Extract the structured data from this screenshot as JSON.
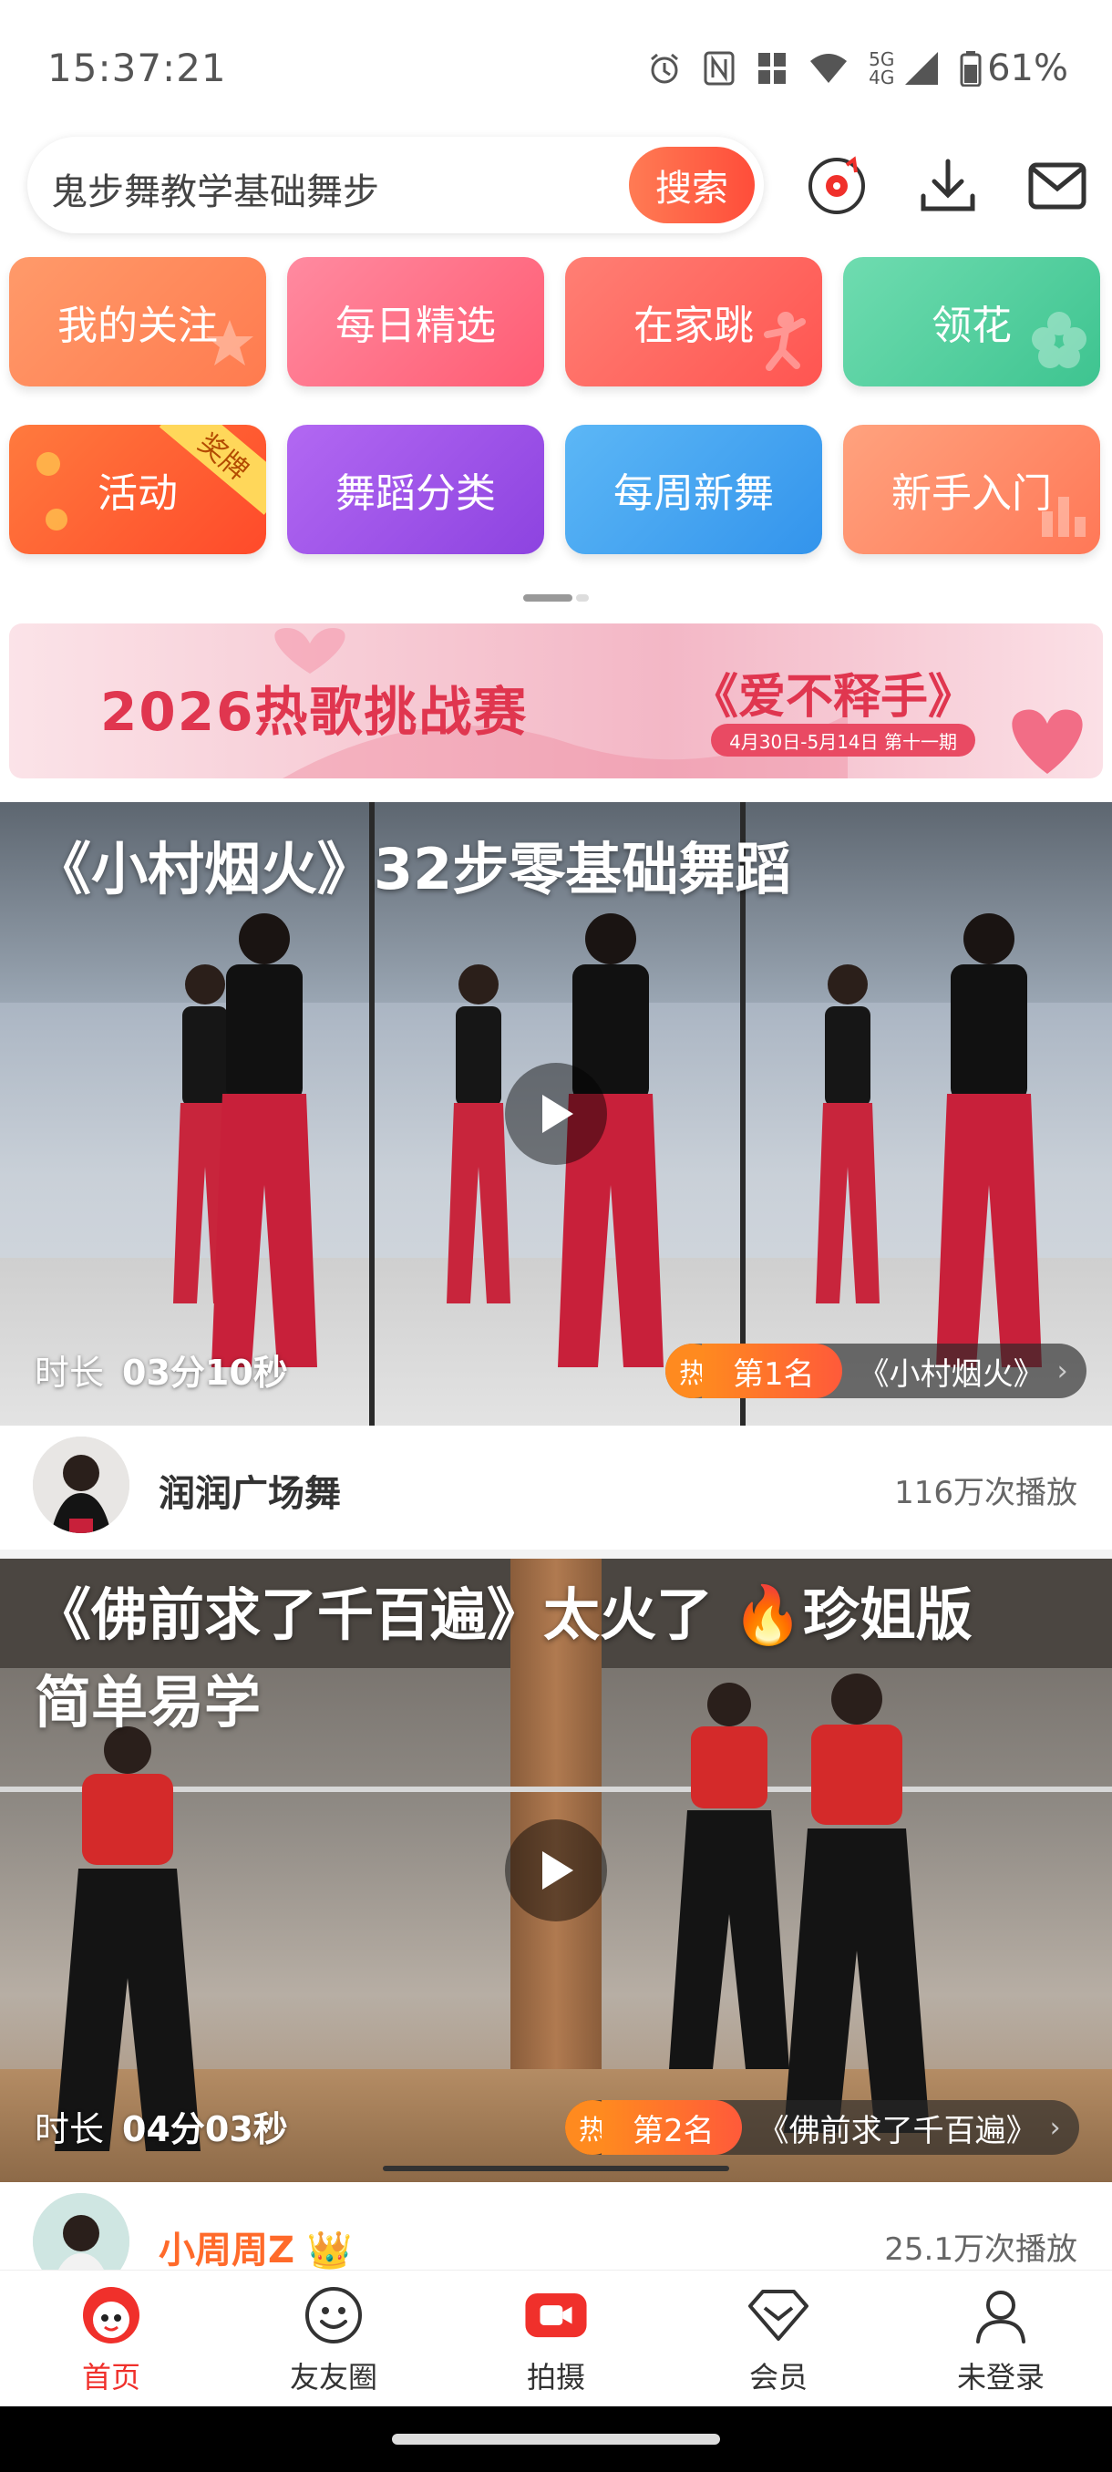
{
  "status_bar": {
    "time": "15:37:21",
    "network": "5G 4G",
    "battery": "61%",
    "icons": [
      "alarm-icon",
      "nfc-icon",
      "sim-icon",
      "wifi-icon",
      "signal-icon",
      "battery-icon"
    ]
  },
  "search": {
    "query": "鬼步舞教学基础舞步",
    "button": "搜索"
  },
  "top_icons": [
    "music-disc-icon",
    "download-icon",
    "mail-icon"
  ],
  "tiles": [
    {
      "label": "我的关注",
      "color": "#ff8a5b"
    },
    {
      "label": "每日精选",
      "color": "#ff6f84"
    },
    {
      "label": "在家跳",
      "color": "#ff6a62"
    },
    {
      "label": "领花",
      "color": "#4fcf9c"
    },
    {
      "label": "活动",
      "color": "#ff6a34",
      "badge": "奖牌"
    },
    {
      "label": "舞蹈分类",
      "color": "#a657ea"
    },
    {
      "label": "每周新舞",
      "color": "#48a9f2"
    },
    {
      "label": "新手入门",
      "color": "#ff8a6a"
    }
  ],
  "banner": {
    "title": "2026热歌挑战赛",
    "song": "《爱不释手》",
    "date": "4月30日-5月14日 第十一期"
  },
  "videos": [
    {
      "title_lines": [
        "《小村烟火》32步零基础舞蹈"
      ],
      "duration_label": "时长",
      "duration": "03分10秒",
      "rank_hot": "热",
      "rank": "第1名",
      "rank_song": "《小村烟火》",
      "author": "润润广场舞",
      "plays": "116万次播放"
    },
    {
      "title_lines": [
        "《佛前求了千百遍》太火了 🔥珍姐版",
        "简单易学"
      ],
      "duration_label": "时长",
      "duration": "04分03秒",
      "rank_hot": "热",
      "rank": "第2名",
      "rank_song": "《佛前求了千百遍》",
      "author": "小周周Z 👑",
      "plays": "25.1万次播放"
    }
  ],
  "bottom_nav": [
    {
      "label": "首页",
      "icon": "home-mascot-icon",
      "active": true
    },
    {
      "label": "友友圈",
      "icon": "smiley-icon",
      "active": false
    },
    {
      "label": "拍摄",
      "icon": "camera-icon",
      "active": false
    },
    {
      "label": "会员",
      "icon": "diamond-icon",
      "active": false
    },
    {
      "label": "未登录",
      "icon": "person-icon",
      "active": false
    }
  ]
}
